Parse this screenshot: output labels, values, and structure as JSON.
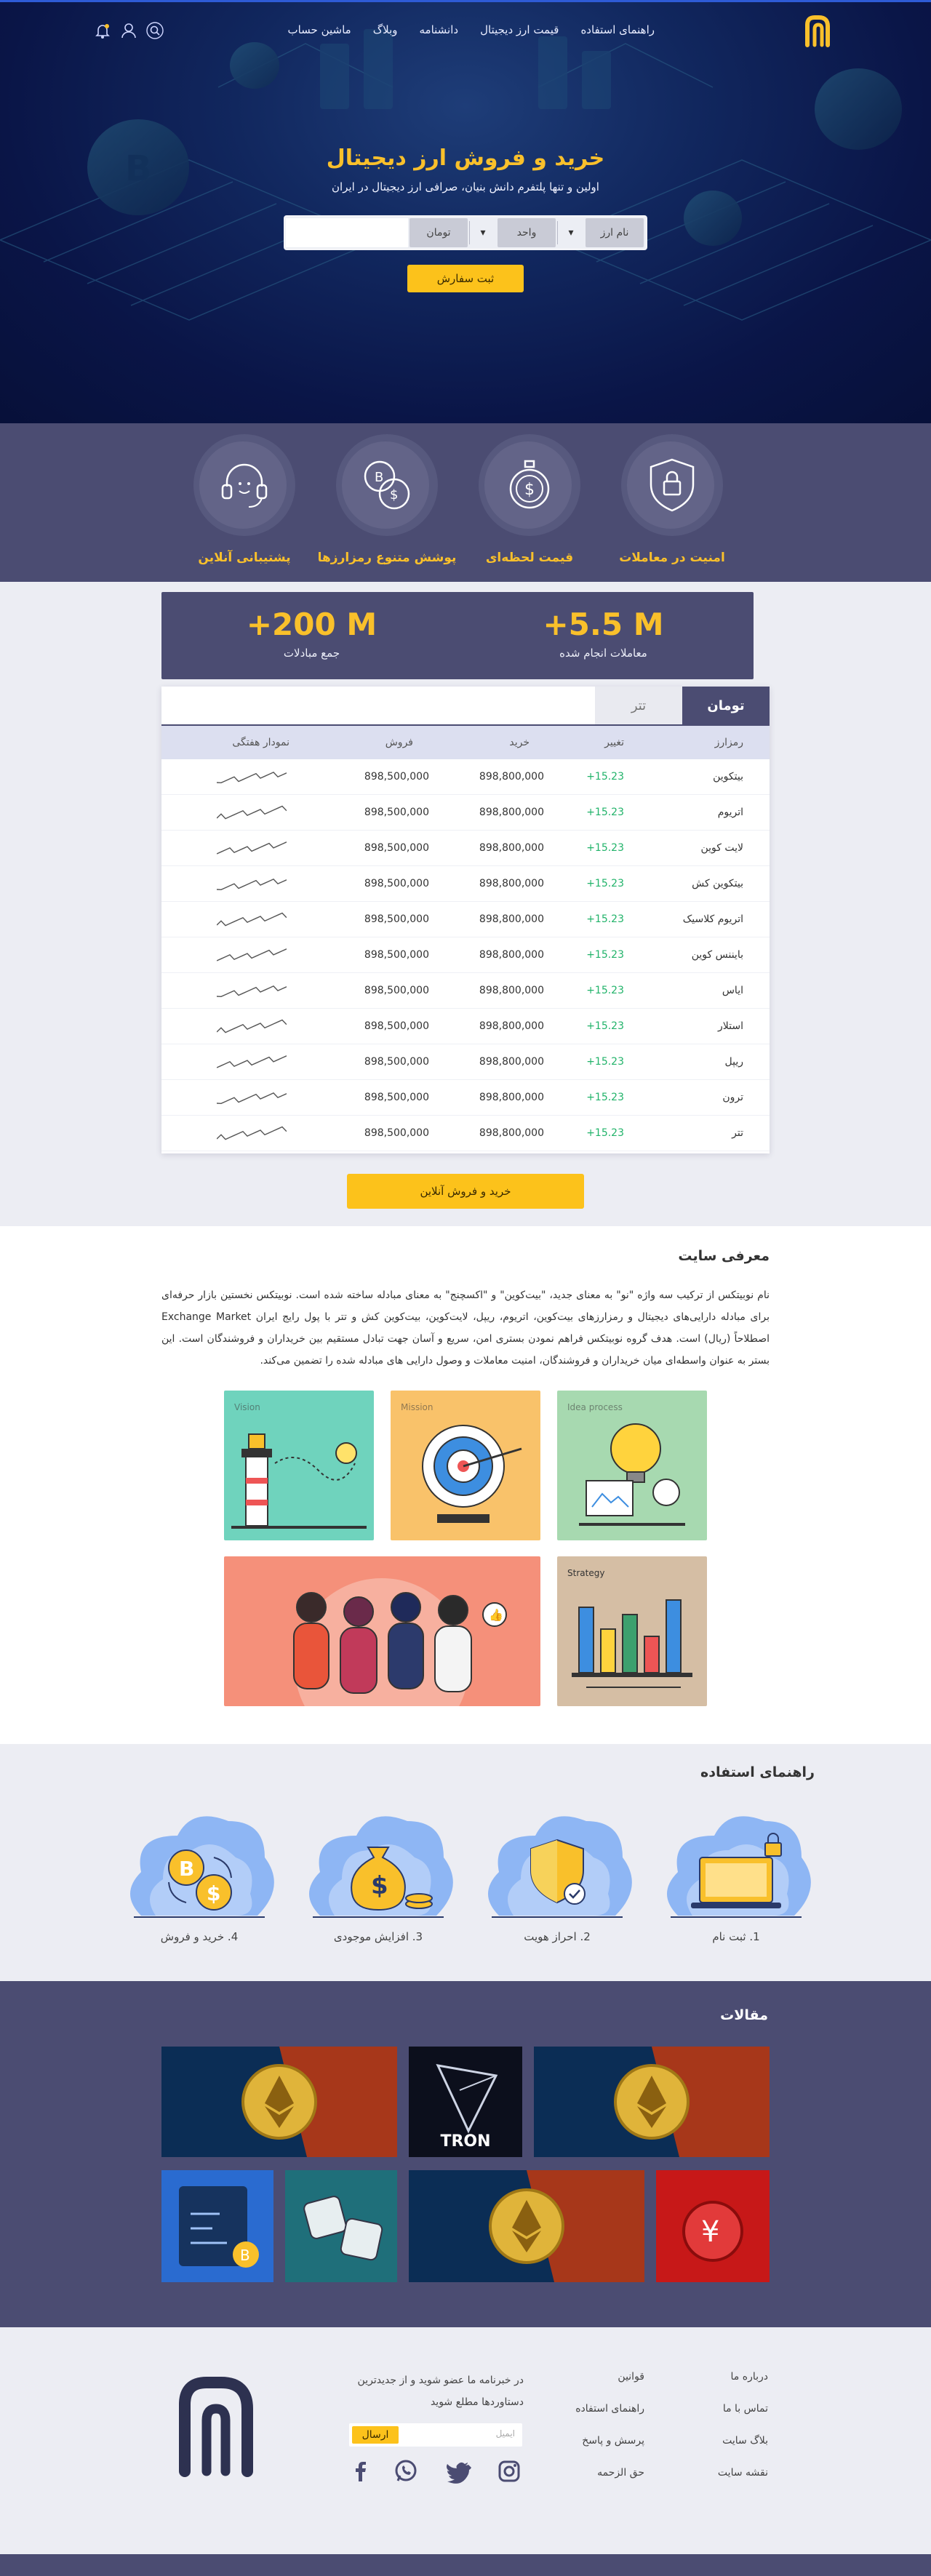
{
  "nav": {
    "links": [
      "راهنمای استفاده",
      "قیمت ارز دیجیتال",
      "دانشنامه",
      "وبلاگ",
      "ماشین حساب"
    ]
  },
  "hero": {
    "title": "خرید و فروش ارز دیجیتال",
    "subtitle": "اولین و تنها پلتفرم دانش بنیان، صرافی ارز دیجیتال در ایران",
    "order": {
      "currency": "نام ارز",
      "unit": "واحد",
      "toman": "تومان",
      "submit": "ثبت سفارش"
    }
  },
  "features": [
    {
      "label": "امنیت در معاملات",
      "icon": "shield-lock-icon"
    },
    {
      "label": "قیمت لحظه‌ای",
      "icon": "stopwatch-dollar-icon"
    },
    {
      "label": "پوشش متنوع رمزارزها",
      "icon": "coins-icon"
    },
    {
      "label": "پشتیبانی آنلاین",
      "icon": "headset-icon"
    }
  ],
  "stats": [
    {
      "value": "+5.5 M",
      "label": "معاملات انجام شده"
    },
    {
      "value": "+200 M",
      "label": "جمع مبادلات"
    }
  ],
  "market": {
    "tabs": [
      "تومان",
      "تتر"
    ],
    "headers": [
      "رمزارز",
      "تغییر",
      "خرید",
      "فروش",
      "نمودار هفتگی"
    ],
    "rows": [
      {
        "name": "بیتکوین",
        "change": "+15.23",
        "buy": "898,800,000",
        "sell": "898,500,000"
      },
      {
        "name": "اتریوم",
        "change": "+15.23",
        "buy": "898,800,000",
        "sell": "898,500,000"
      },
      {
        "name": "لایت کوین",
        "change": "+15.23",
        "buy": "898,800,000",
        "sell": "898,500,000"
      },
      {
        "name": "بیتکوین کش",
        "change": "+15.23",
        "buy": "898,800,000",
        "sell": "898,500,000"
      },
      {
        "name": "اتریوم کلاسیک",
        "change": "+15.23",
        "buy": "898,800,000",
        "sell": "898,500,000"
      },
      {
        "name": "بایننس کوین",
        "change": "+15.23",
        "buy": "898,800,000",
        "sell": "898,500,000"
      },
      {
        "name": "ایاس",
        "change": "+15.23",
        "buy": "898,800,000",
        "sell": "898,500,000"
      },
      {
        "name": "استلار",
        "change": "+15.23",
        "buy": "898,800,000",
        "sell": "898,500,000"
      },
      {
        "name": "ریپل",
        "change": "+15.23",
        "buy": "898,800,000",
        "sell": "898,500,000"
      },
      {
        "name": "ترون",
        "change": "+15.23",
        "buy": "898,800,000",
        "sell": "898,500,000"
      },
      {
        "name": "تتر",
        "change": "+15.23",
        "buy": "898,800,000",
        "sell": "898,500,000"
      }
    ],
    "cta": "خرید و فروش آنلاین"
  },
  "about": {
    "title": "معرفی سایت",
    "text": "نام نوبیتکس از ترکیب سه واژه \"نو\" به معنای جدید، \"بیت‌کوین\" و \"اکسچنج\" به معنای مبادله ساخته شده است. نوبیتکس نخستین بازار حرفه‌ای برای مبادله دارایی‌های دیجیتال و رمزارزهای بیت‌کوین، اتریوم، ریپل، لایت‌کوین، بیت‌کوین کش و تتر با پول رایج ایران Exchange Market اصطلاحاً (ریال) است. هدف گروه نوبیتکس فراهم نمودن بستری امن، سریع و آسان جهت تبادل مستقیم بین خریداران و فروشندگان است. این بستر به عنوان واسطه‌ای میان خریداران و فروشندگان، امنیت معاملات و وصول دارایی های مبادله شده را تضمین می‌کند.",
    "illustrations": [
      "Vision",
      "Mission",
      "Idea process",
      "Strategy"
    ]
  },
  "guide": {
    "title": "راهنمای استفاده",
    "steps": [
      "1. ثبت نام",
      "2. احراز هویت",
      "3. افزایش موجودی",
      "4. خرید و فروش"
    ]
  },
  "articles": {
    "title": "مقالات",
    "tron_label": "TRON"
  },
  "footer": {
    "col1": [
      "درباره ما",
      "تماس با ما",
      "بلاگ سایت",
      "نقشه سایت"
    ],
    "col2": [
      "قوانین",
      "راهنمای استفاده",
      "پرسش و پاسخ",
      "حق الزحمه"
    ],
    "newsletter_text": "در خبرنامه ما عضو شوید و از جدیدترین دستاوردها مطلع شوید",
    "newsletter_placeholder": "ایمیل",
    "newsletter_button": "ارسال"
  },
  "colors": {
    "brand": "#4b4c72",
    "accent": "#fcc21b",
    "positive": "#22b36a",
    "hero_dark": "#0a1547"
  }
}
